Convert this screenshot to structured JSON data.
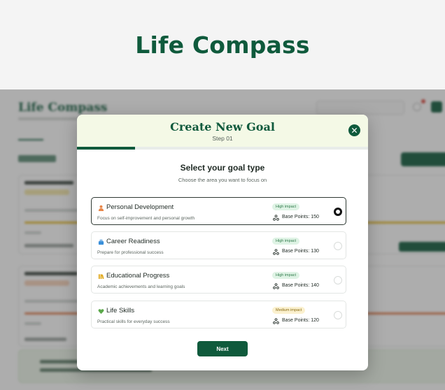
{
  "banner": {
    "title": "Life Compass"
  },
  "modal": {
    "title": "Create New Goal",
    "step": "Step 01",
    "progress": 0.2,
    "question": "Select your goal type",
    "question_sub": "Choose the area you want to focus on",
    "next_label": "Next",
    "options": [
      {
        "name": "Personal Development",
        "desc": "Focus on self-improvement and personal growth",
        "impact": "High impact",
        "impact_level": "high",
        "points": "Base Points: 150",
        "selected": true,
        "icon": "person-icon",
        "icon_color": "#e8874a"
      },
      {
        "name": "Career Readiness",
        "desc": "Prepare for professional success",
        "impact": "High impact",
        "impact_level": "high",
        "points": "Base Points: 130",
        "selected": false,
        "icon": "briefcase-icon",
        "icon_color": "#3a8fd9"
      },
      {
        "name": "Educational Progress",
        "desc": "Academic achievements and learning goals",
        "impact": "High impact",
        "impact_level": "high",
        "points": "Base Points: 140",
        "selected": false,
        "icon": "books-icon",
        "icon_color": "#e0a81a"
      },
      {
        "name": "Life Skills",
        "desc": "Practical skills for everyday success",
        "impact": "Medium impact",
        "impact_level": "medium",
        "points": "Base Points: 120",
        "selected": false,
        "icon": "heart-icon",
        "icon_color": "#5aa84a"
      }
    ]
  },
  "colors": {
    "brand": "#0f5a3c",
    "header_bg": "#f4f9e6"
  }
}
